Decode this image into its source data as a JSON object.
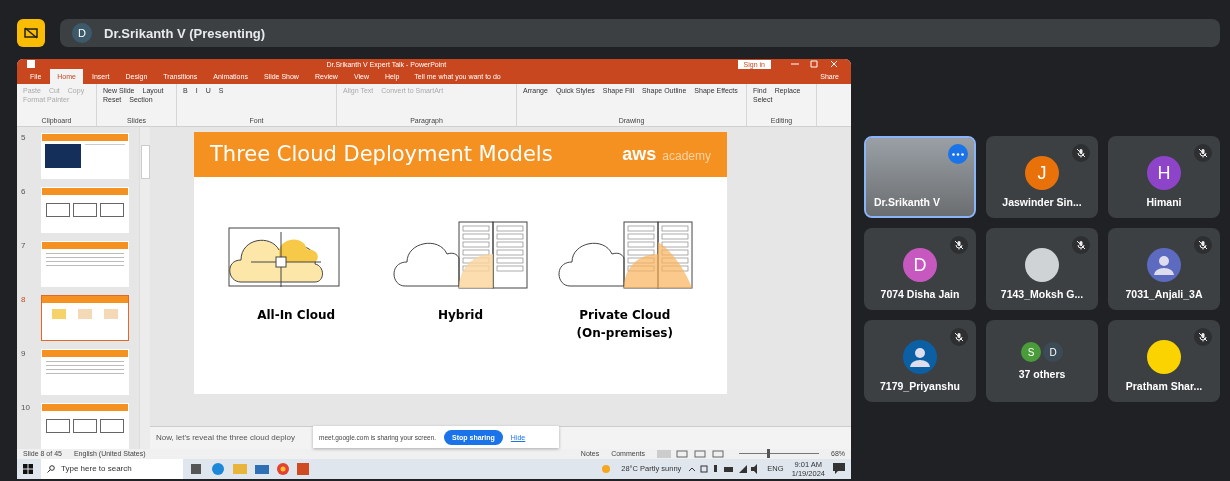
{
  "meeting": {
    "presenter_initial": "D",
    "presenter_label": "Dr.Srikanth V (Presenting)"
  },
  "powerpoint": {
    "title": "Dr.Srikanth V Expert Talk  -  PowerPoint",
    "sign_in": "Sign in",
    "share": "Share",
    "tell_me": "Tell me what you want to do",
    "tabs": [
      {
        "label": "File",
        "selected": false
      },
      {
        "label": "Home",
        "selected": true
      },
      {
        "label": "Insert",
        "selected": false
      },
      {
        "label": "Design",
        "selected": false
      },
      {
        "label": "Transitions",
        "selected": false
      },
      {
        "label": "Animations",
        "selected": false
      },
      {
        "label": "Slide Show",
        "selected": false
      },
      {
        "label": "Review",
        "selected": false
      },
      {
        "label": "View",
        "selected": false
      },
      {
        "label": "Help",
        "selected": false
      }
    ],
    "ribbon_groups": [
      {
        "kind": "clipboard",
        "label": "Clipboard",
        "items": [
          "Paste",
          "Cut",
          "Copy",
          "Format Painter"
        ]
      },
      {
        "kind": "slides",
        "label": "Slides",
        "items": [
          "New Slide",
          "Layout",
          "Reset",
          "Section"
        ]
      },
      {
        "kind": "font",
        "label": "Font",
        "items": [
          "B",
          "I",
          "U",
          "S"
        ]
      },
      {
        "kind": "paragraph",
        "label": "Paragraph",
        "items": [
          "Align Text",
          "Convert to SmartArt"
        ]
      },
      {
        "kind": "drawing",
        "label": "Drawing",
        "items": [
          "Arrange",
          "Quick Styles",
          "Shape Fill",
          "Shape Outline",
          "Shape Effects"
        ]
      },
      {
        "kind": "editing",
        "label": "Editing",
        "items": [
          "Find",
          "Replace",
          "Select"
        ]
      }
    ],
    "thumbnails": [
      {
        "number": "5",
        "kind": "image",
        "selected": false
      },
      {
        "number": "6",
        "kind": "boxes",
        "selected": false
      },
      {
        "number": "7",
        "kind": "text",
        "selected": false
      },
      {
        "number": "8",
        "kind": "icons",
        "selected": true
      },
      {
        "number": "9",
        "kind": "text",
        "selected": false
      },
      {
        "number": "10",
        "kind": "boxes",
        "selected": false
      }
    ],
    "slide": {
      "title": "Three Cloud Deployment Models",
      "logo": "aws",
      "logo_sub": "academy",
      "models": [
        {
          "kind": "all-in",
          "label": "All-In Cloud"
        },
        {
          "kind": "hybrid",
          "label": "Hybrid"
        },
        {
          "kind": "private",
          "label": "Private Cloud\n(On-premises)"
        }
      ]
    },
    "notes": "Now, let's reveal the three cloud deploy",
    "status": {
      "slide": "Slide 8 of 45",
      "language": "English (United States)",
      "notes": "Notes",
      "comments": "Comments",
      "zoom": "68%",
      "zoom_slider": {
        "level": 0.35
      }
    },
    "share_bar": {
      "message": "meet.google.com is sharing your screen.",
      "stop": "Stop sharing",
      "hide": "Hide"
    },
    "taskbar": {
      "search_placeholder": "Type here to search",
      "weather": "28°C  Partly sunny",
      "language": "ENG",
      "time": "9:01 AM",
      "date": "1/19/2024"
    }
  },
  "participants": [
    {
      "kind": "video",
      "name": "Dr.Srikanth V",
      "muted": false,
      "selected": true
    },
    {
      "kind": "initial",
      "name": "Jaswinder Sin...",
      "initial": "J",
      "color": "#e8710a",
      "muted": true,
      "selected": false
    },
    {
      "kind": "initial",
      "name": "Himani",
      "initial": "H",
      "color": "#8e44c8",
      "muted": true,
      "selected": false
    },
    {
      "kind": "initial",
      "name": "7074 Disha Jain",
      "initial": "D",
      "color": "#c658c0",
      "muted": true,
      "selected": false
    },
    {
      "kind": "photo",
      "name": "7143_Moksh G...",
      "muted": true,
      "selected": false
    },
    {
      "kind": "silhouette",
      "name": "7031_Anjali_3A",
      "color": "#5c6bc0",
      "muted": true,
      "selected": false
    },
    {
      "kind": "silhouette",
      "name": "7179_Priyanshu",
      "color": "#0b5fa5",
      "muted": true,
      "selected": false
    },
    {
      "kind": "others",
      "name": "37 others",
      "initials": [
        {
          "initial": "S",
          "color": "#4a9c3a"
        },
        {
          "initial": "D",
          "color": "#3c4a55"
        }
      ],
      "muted": false,
      "selected": false
    },
    {
      "kind": "blank",
      "name": "Pratham Shar...",
      "color": "#fbd400",
      "muted": true,
      "selected": false
    }
  ]
}
